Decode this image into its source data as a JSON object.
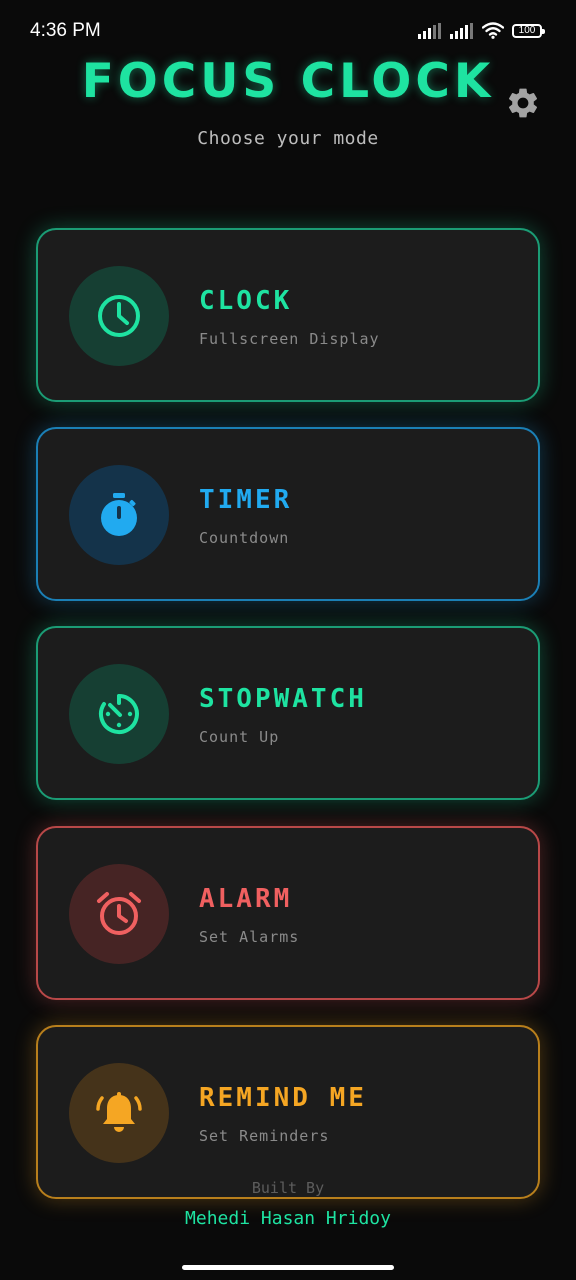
{
  "status_bar": {
    "time": "4:36 PM",
    "battery": "100",
    "icons": [
      "signal-icon",
      "signal-icon",
      "wifi-icon",
      "battery-icon"
    ]
  },
  "header": {
    "title": "FOCUS CLOCK",
    "subtitle": "Choose your mode",
    "settings_icon": "gear-icon"
  },
  "modes": [
    {
      "title": "CLOCK",
      "description": "Fullscreen Display",
      "icon": "clock-icon",
      "color": "#1ee3a1",
      "border": "#1b9c75",
      "glow": "rgba(30,227,161,0.30)",
      "icon_bg": "#163f33"
    },
    {
      "title": "TIMER",
      "description": "Countdown",
      "icon": "timer-icon",
      "color": "#21aaf0",
      "border": "#1b7fb5",
      "glow": "rgba(33,170,240,0.30)",
      "icon_bg": "#14334a"
    },
    {
      "title": "STOPWATCH",
      "description": "Count Up",
      "icon": "stopwatch-icon",
      "color": "#1ee3a1",
      "border": "#1b9c75",
      "glow": "rgba(30,227,161,0.30)",
      "icon_bg": "#163f33"
    },
    {
      "title": "ALARM",
      "description": "Set Alarms",
      "icon": "alarm-icon",
      "color": "#f06060",
      "border": "#b84848",
      "glow": "rgba(240,96,96,0.30)",
      "icon_bg": "#462424"
    },
    {
      "title": "REMIND ME",
      "description": "Set Reminders",
      "icon": "bell-icon",
      "color": "#f5a623",
      "border": "#b87f1c",
      "glow": "rgba(245,166,35,0.30)",
      "icon_bg": "#45331a"
    }
  ],
  "footer": {
    "built_by": "Built By",
    "author": "Mehedi Hasan Hridoy"
  }
}
